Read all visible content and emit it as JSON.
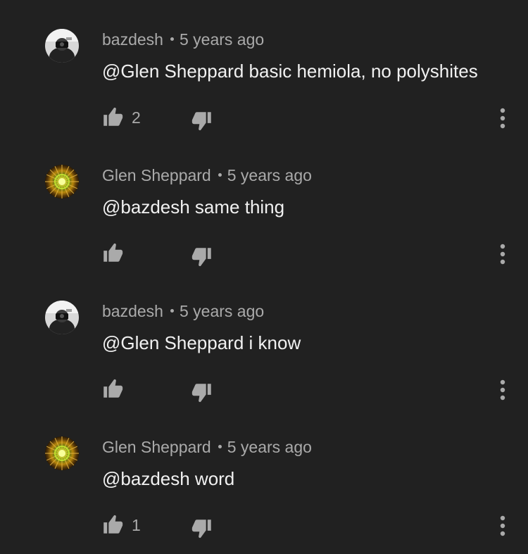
{
  "colors": {
    "background": "#212121",
    "primary_text": "#f1f1f1",
    "secondary_text": "#aaaaaa",
    "icon": "#aaaaaa"
  },
  "comments": [
    {
      "author": "bazdesh",
      "time": "5 years ago",
      "text": "@Glen Sheppard basic hemiola, no polyshites",
      "likes": "2",
      "avatar": "photo-avatar"
    },
    {
      "author": "Glen Sheppard",
      "time": "5 years ago",
      "text": "@bazdesh same thing",
      "likes": "",
      "avatar": "mandala-avatar"
    },
    {
      "author": "bazdesh",
      "time": "5 years ago",
      "text": "@Glen Sheppard i know",
      "likes": "",
      "avatar": "photo-avatar"
    },
    {
      "author": "Glen Sheppard",
      "time": "5 years ago",
      "text": "@bazdesh word",
      "likes": "1",
      "avatar": "mandala-avatar"
    }
  ],
  "icons": {
    "like": "thumbs-up-icon",
    "dislike": "thumbs-down-icon",
    "more": "more-vertical-icon"
  }
}
